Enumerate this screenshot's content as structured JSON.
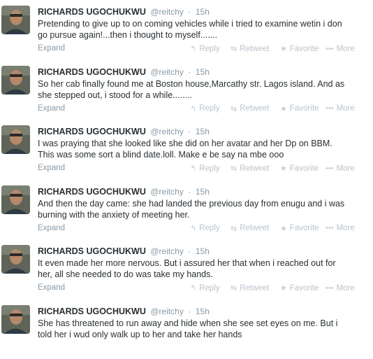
{
  "tweets": [
    {
      "fullname": "RICHARDS UGOCHUKWU",
      "username": "@reitchy",
      "dot": "·",
      "time": "15h",
      "text": "Pretending to give up to on coming vehicles while i tried to examine wetin i don\ngo pursue again!...then i thought to myself.......",
      "expand": "Expand"
    },
    {
      "fullname": "RICHARDS UGOCHUKWU",
      "username": "@reitchy",
      "dot": "·",
      "time": "15h",
      "text": "So her cab finally found me at Boston house,Marcathy str. Lagos island. And as\nshe stepped out, i stood for a while........",
      "expand": "Expand"
    },
    {
      "fullname": "RICHARDS UGOCHUKWU",
      "username": "@reitchy",
      "dot": "·",
      "time": "15h",
      "text": "I was praying that she looked like she did on her avatar and her Dp on BBM.\nThis was some sort a blind date.loll. Make e be say na mbe ooo",
      "expand": "Expand"
    },
    {
      "fullname": "RICHARDS UGOCHUKWU",
      "username": "@reitchy",
      "dot": "·",
      "time": "15h",
      "text": "And then the day came: she had landed the previous day from enugu and i was\nburning with the anxiety of meeting her.",
      "expand": "Expand"
    },
    {
      "fullname": "RICHARDS UGOCHUKWU",
      "username": "@reitchy",
      "dot": "·",
      "time": "15h",
      "text": "It even made her more nervous. But i assured her that when i reached out for\nher, all she needed to do was take my hands.",
      "expand": "Expand"
    },
    {
      "fullname": "RICHARDS UGOCHUKWU",
      "username": "@reitchy",
      "dot": "·",
      "time": "15h",
      "text": "She has threatened to run away and hide when she see set eyes on me. But i\ntold her i wud only walk up to her and take her hands",
      "expand": ""
    }
  ],
  "actions": {
    "reply": "Reply",
    "retweet": "Retweet",
    "favorite": "Favorite",
    "more": "More"
  },
  "icons": {
    "reply": "reply-icon",
    "retweet": "retweet-icon",
    "favorite": "star-icon",
    "more": "ellipsis-icon"
  },
  "colors": {
    "name": "#292f33",
    "meta": "#8899a6",
    "action": "#b9c3cb"
  }
}
